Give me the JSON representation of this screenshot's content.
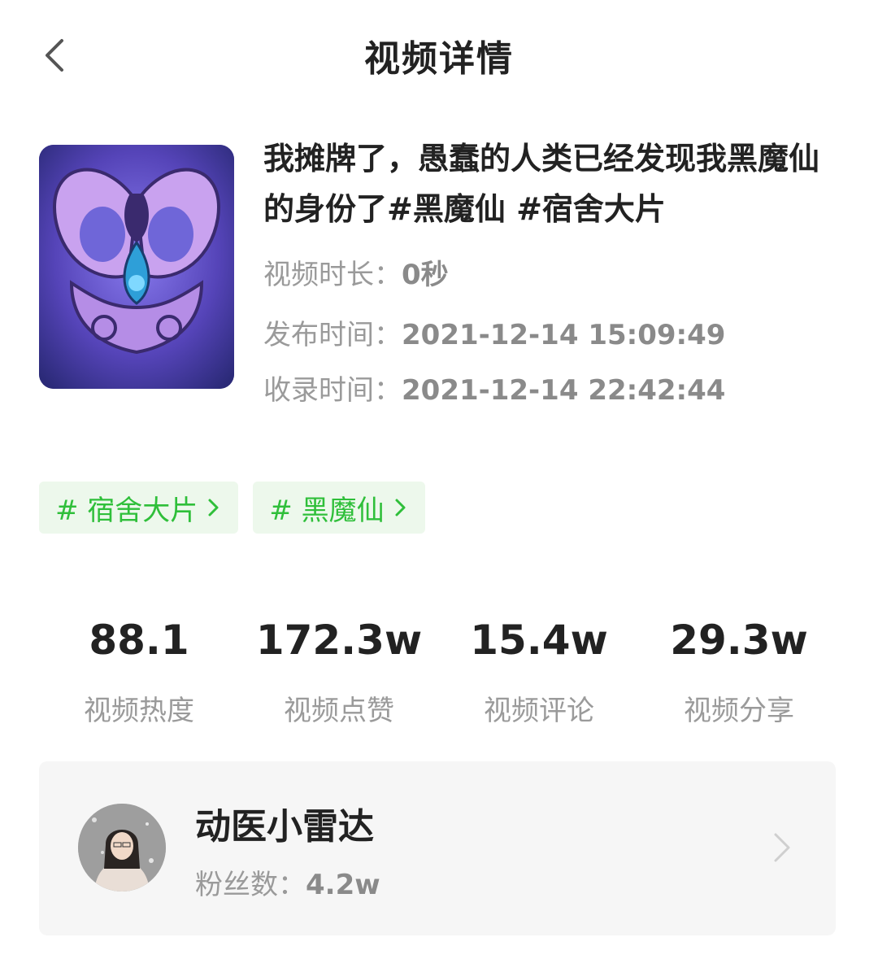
{
  "header": {
    "title": "视频详情",
    "back_icon": "chevron-left-icon"
  },
  "video": {
    "title": "我摊牌了，愚蠢的人类已经发现我黑魔仙的身份了#黑魔仙 #宿舍大片",
    "duration_label": "视频时长：",
    "duration_value": "0秒",
    "publish_label": "发布时间：",
    "publish_value": "2021-12-14 15:09:49",
    "record_label": "收录时间：",
    "record_value": "2021-12-14 22:42:44"
  },
  "tags": [
    {
      "label": "# 宿舍大片"
    },
    {
      "label": "# 黑魔仙"
    }
  ],
  "stats": [
    {
      "value": "88.1",
      "label": "视频热度"
    },
    {
      "value": "172.3w",
      "label": "视频点赞"
    },
    {
      "value": "15.4w",
      "label": "视频评论"
    },
    {
      "value": "29.3w",
      "label": "视频分享"
    }
  ],
  "author": {
    "name": "动医小雷达",
    "followers_label": "粉丝数：",
    "followers_value": "4.2w"
  },
  "colors": {
    "accent_green": "#2fbf3a",
    "tag_bg": "#edf8ec",
    "card_bg": "#f6f6f6",
    "muted_text": "#9a9a9a"
  }
}
